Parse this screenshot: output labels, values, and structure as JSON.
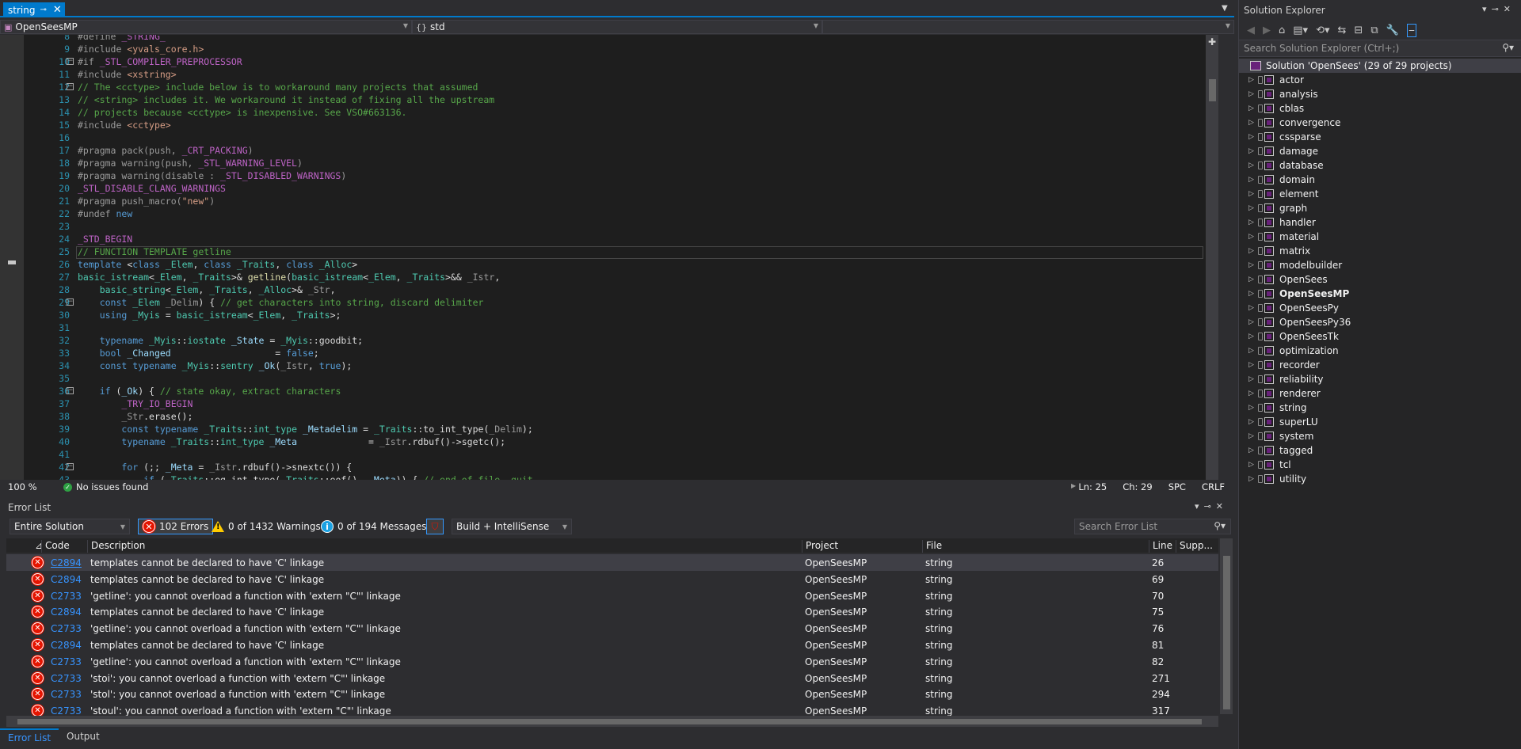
{
  "editor_tab": {
    "title": "string"
  },
  "navbar": {
    "project": "OpenSeesMP",
    "scope": "std",
    "member": ""
  },
  "editor": {
    "lines": [
      {
        "n": "8",
        "html": "<span class='pp'>#define</span> <span class='mc'>_STRING_</span>"
      },
      {
        "n": "9",
        "html": "<span class='pp'>#include</span> <span class='st'>&lt;yvals_core.h&gt;</span>"
      },
      {
        "n": "10",
        "html": "<span class='pp'>#if</span> <span class='mc'>_STL_COMPILER_PREPROCESSOR</span>",
        "fold": true
      },
      {
        "n": "11",
        "html": "<span class='pp'>#include</span> <span class='st'>&lt;xstring&gt;</span>"
      },
      {
        "n": "12",
        "html": "<span class='cm'>// The &lt;cctype&gt; include below is to workaround many projects that assumed</span>",
        "fold": true
      },
      {
        "n": "13",
        "html": "<span class='cm'>// &lt;string&gt; includes it. We workaround it instead of fixing all the upstream</span>"
      },
      {
        "n": "14",
        "html": "<span class='cm'>// projects because &lt;cctype&gt; is inexpensive. See VSO#663136.</span>"
      },
      {
        "n": "15",
        "html": "<span class='pp'>#include</span> <span class='st'>&lt;cctype&gt;</span>"
      },
      {
        "n": "16",
        "html": ""
      },
      {
        "n": "17",
        "html": "<span class='pp'>#pragma</span> <span class='pp'>pack(push, </span><span class='mc'>_CRT_PACKING</span><span class='pp'>)</span>"
      },
      {
        "n": "18",
        "html": "<span class='pp'>#pragma</span> <span class='pp'>warning(push, </span><span class='mc'>_STL_WARNING_LEVEL</span><span class='pp'>)</span>"
      },
      {
        "n": "19",
        "html": "<span class='pp'>#pragma</span> <span class='pp'>warning(disable : </span><span class='mc'>_STL_DISABLED_WARNINGS</span><span class='pp'>)</span>"
      },
      {
        "n": "20",
        "html": "<span class='mc'>_STL_DISABLE_CLANG_WARNINGS</span>"
      },
      {
        "n": "21",
        "html": "<span class='pp'>#pragma</span> <span class='pp'>push_macro(</span><span class='st'>\"new\"</span><span class='pp'>)</span>"
      },
      {
        "n": "22",
        "html": "<span class='pp'>#undef</span> <span class='kw'>new</span>"
      },
      {
        "n": "23",
        "html": ""
      },
      {
        "n": "24",
        "html": "<span class='mc'>_STD_BEGIN</span>"
      },
      {
        "n": "25",
        "html": "<span class='cm'>// FUNCTION TEMPLATE getline</span>"
      },
      {
        "n": "26",
        "html": "<span class='kw'>template</span> &lt;<span class='kw'>class</span> <span class='ty'>_Elem</span>, <span class='kw'>class</span> <span class='ty'>_Traits</span>, <span class='kw'>class</span> <span class='ty'>_Alloc</span>&gt;"
      },
      {
        "n": "27",
        "html": "<span class='ty'>basic_istream</span>&lt;<span class='ty'>_Elem</span>, <span class='ty'>_Traits</span>&gt;&amp; <span class='fn'>getline</span>(<span class='ty'>basic_istream</span>&lt;<span class='ty'>_Elem</span>, <span class='ty'>_Traits</span>&gt;&amp;&amp; <span class='pa'>_Istr</span>,"
      },
      {
        "n": "28",
        "html": "    <span class='ty'>basic_string</span>&lt;<span class='ty'>_Elem</span>, <span class='ty'>_Traits</span>, <span class='ty'>_Alloc</span>&gt;&amp; <span class='pa'>_Str</span>,"
      },
      {
        "n": "29",
        "html": "    <span class='kw'>const</span> <span class='ty'>_Elem</span> <span class='pa'>_Delim</span>) { <span class='cm'>// get characters into string, discard delimiter</span>",
        "fold": true
      },
      {
        "n": "30",
        "html": "    <span class='kw'>using</span> <span class='ty'>_Myis</span> = <span class='ty'>basic_istream</span>&lt;<span class='ty'>_Elem</span>, <span class='ty'>_Traits</span>&gt;;"
      },
      {
        "n": "31",
        "html": ""
      },
      {
        "n": "32",
        "html": "    <span class='kw'>typename</span> <span class='ty'>_Myis</span>::<span class='ty'>iostate</span> <span class='lv'>_State</span> = <span class='ty'>_Myis</span>::goodbit;"
      },
      {
        "n": "33",
        "html": "    <span class='kw'>bool</span> <span class='lv'>_Changed</span>                   = <span class='kw'>false</span>;"
      },
      {
        "n": "34",
        "html": "    <span class='kw'>const</span> <span class='kw'>typename</span> <span class='ty'>_Myis</span>::<span class='ty'>sentry</span> <span class='lv'>_Ok</span>(<span class='pa'>_Istr</span>, <span class='kw'>true</span>);"
      },
      {
        "n": "35",
        "html": ""
      },
      {
        "n": "36",
        "html": "    <span class='kw'>if</span> (<span class='lv'>_Ok</span>) { <span class='cm'>// state okay, extract characters</span>",
        "fold": true
      },
      {
        "n": "37",
        "html": "        <span class='mc'>_TRY_IO_BEGIN</span>"
      },
      {
        "n": "38",
        "html": "        <span class='pa'>_Str</span>.erase();"
      },
      {
        "n": "39",
        "html": "        <span class='kw'>const</span> <span class='kw'>typename</span> <span class='ty'>_Traits</span>::<span class='ty'>int_type</span> <span class='lv'>_Metadelim</span> = <span class='ty'>_Traits</span>::to_int_type(<span class='pa'>_Delim</span>);"
      },
      {
        "n": "40",
        "html": "        <span class='kw'>typename</span> <span class='ty'>_Traits</span>::<span class='ty'>int_type</span> <span class='lv'>_Meta</span>             = <span class='pa'>_Istr</span>.rdbuf()-&gt;sgetc();"
      },
      {
        "n": "41",
        "html": ""
      },
      {
        "n": "42",
        "html": "        <span class='kw'>for</span> (;; <span class='lv'>_Meta</span> = <span class='pa'>_Istr</span>.rdbuf()-&gt;snextc()) {",
        "fold": true
      },
      {
        "n": "43",
        "html": "            <span class='kw'>if</span> (<span class='ty'>_Traits</span>::eq_int_type(<span class='ty'>_Traits</span>::eof(), <span class='lv'>_Meta</span>)) { <span class='cm'>// end of file, quit</span>"
      }
    ]
  },
  "editor_status": {
    "zoom": "100 %",
    "issues": "No issues found",
    "ln": "Ln: 25",
    "ch": "Ch: 29",
    "spc": "SPC",
    "crlf": "CRLF"
  },
  "error_list": {
    "title": "Error List",
    "scope": "Entire Solution",
    "errors_label": "102 Errors",
    "warnings_label": "0 of 1432 Warnings",
    "messages_label": "0 of 194 Messages",
    "build_filter": "Build + IntelliSense",
    "search_placeholder": "Search Error List",
    "columns": {
      "code": "Code",
      "description": "Description",
      "project": "Project",
      "file": "File",
      "line": "Line",
      "suppression": "Supp..."
    },
    "rows": [
      {
        "code": "C2894",
        "desc": "templates cannot be declared to have 'C' linkage",
        "project": "OpenSeesMP",
        "file": "string",
        "line": "26"
      },
      {
        "code": "C2894",
        "desc": "templates cannot be declared to have 'C' linkage",
        "project": "OpenSeesMP",
        "file": "string",
        "line": "69"
      },
      {
        "code": "C2733",
        "desc": "'getline': you cannot overload a function with 'extern \"C\"' linkage",
        "project": "OpenSeesMP",
        "file": "string",
        "line": "70"
      },
      {
        "code": "C2894",
        "desc": "templates cannot be declared to have 'C' linkage",
        "project": "OpenSeesMP",
        "file": "string",
        "line": "75"
      },
      {
        "code": "C2733",
        "desc": "'getline': you cannot overload a function with 'extern \"C\"' linkage",
        "project": "OpenSeesMP",
        "file": "string",
        "line": "76"
      },
      {
        "code": "C2894",
        "desc": "templates cannot be declared to have 'C' linkage",
        "project": "OpenSeesMP",
        "file": "string",
        "line": "81"
      },
      {
        "code": "C2733",
        "desc": "'getline': you cannot overload a function with 'extern \"C\"' linkage",
        "project": "OpenSeesMP",
        "file": "string",
        "line": "82"
      },
      {
        "code": "C2733",
        "desc": "'stoi': you cannot overload a function with 'extern \"C\"' linkage",
        "project": "OpenSeesMP",
        "file": "string",
        "line": "271"
      },
      {
        "code": "C2733",
        "desc": "'stol': you cannot overload a function with 'extern \"C\"' linkage",
        "project": "OpenSeesMP",
        "file": "string",
        "line": "294"
      },
      {
        "code": "C2733",
        "desc": "'stoul': you cannot overload a function with 'extern \"C\"' linkage",
        "project": "OpenSeesMP",
        "file": "string",
        "line": "317"
      }
    ]
  },
  "bottom_tabs": [
    "Error List",
    "Output"
  ],
  "solution_explorer": {
    "title": "Solution Explorer",
    "search_placeholder": "Search Solution Explorer (Ctrl+;)",
    "solution_label": "Solution 'OpenSees' (29 of 29 projects)",
    "startup_project": "OpenSeesMP",
    "projects": [
      "actor",
      "analysis",
      "cblas",
      "convergence",
      "cssparse",
      "damage",
      "database",
      "domain",
      "element",
      "graph",
      "handler",
      "material",
      "matrix",
      "modelbuilder",
      "OpenSees",
      "OpenSeesMP",
      "OpenSeesPy",
      "OpenSeesPy36",
      "OpenSeesTk",
      "optimization",
      "recorder",
      "reliability",
      "renderer",
      "string",
      "superLU",
      "system",
      "tagged",
      "tcl",
      "utility"
    ]
  }
}
